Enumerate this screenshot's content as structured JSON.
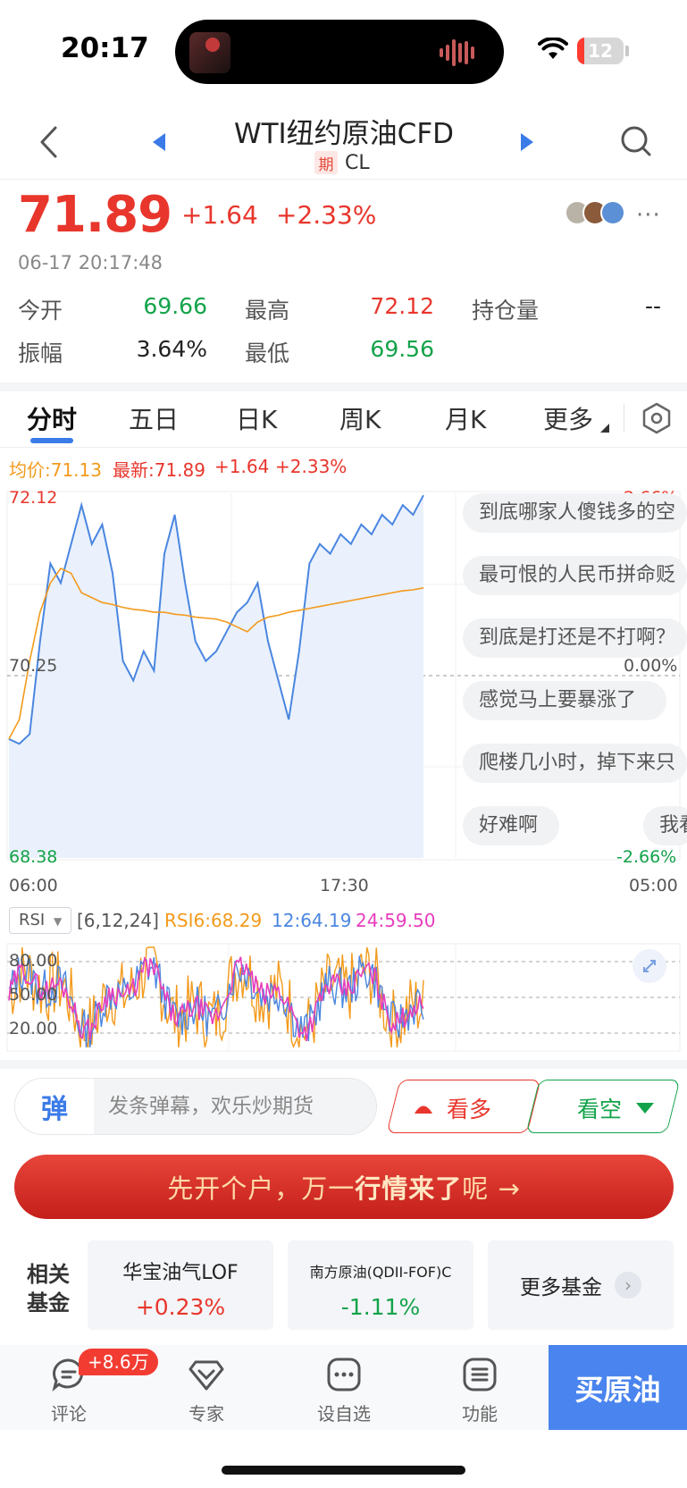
{
  "status_bar": {
    "time": "20:17",
    "battery": "12"
  },
  "header": {
    "title": "WTI纽约原油CFD",
    "tag": "期",
    "code": "CL"
  },
  "quote": {
    "price": "71.89",
    "change": "+1.64",
    "change_pct": "+2.33%",
    "datetime": "06-17 20:17:48",
    "more": "···"
  },
  "stats": {
    "open_label": "今开",
    "open": "69.66",
    "high_label": "最高",
    "high": "72.12",
    "oi_label": "持仓量",
    "oi": "--",
    "amp_label": "振幅",
    "amp": "3.64%",
    "low_label": "最低",
    "low": "69.56"
  },
  "tabs": [
    "分时",
    "五日",
    "日K",
    "周K",
    "月K",
    "更多"
  ],
  "legend": {
    "avg": "均价:71.13",
    "latest": "最新:71.89",
    "change": "+1.64",
    "pct": "+2.33%"
  },
  "chart_data": {
    "type": "line",
    "y_ticks_left": [
      "72.12",
      "70.25",
      "68.38"
    ],
    "y_ticks_right": [
      "2.66%",
      "0.00%",
      "-2.66%"
    ],
    "x_ticks": [
      "06:00",
      "17:30",
      "05:00"
    ],
    "ylim": [
      68.38,
      72.12
    ],
    "reference": 70.25,
    "grid": true,
    "series": [
      {
        "name": "最新",
        "color": "#4a86e0",
        "values": [
          69.6,
          69.55,
          69.65,
          70.6,
          71.4,
          71.2,
          71.6,
          72.0,
          71.6,
          71.8,
          71.3,
          70.4,
          70.2,
          70.5,
          70.3,
          71.5,
          71.9,
          71.2,
          70.6,
          70.4,
          70.5,
          70.7,
          70.9,
          71.0,
          71.2,
          70.6,
          70.2,
          69.8,
          70.5,
          71.4,
          71.6,
          71.5,
          71.7,
          71.6,
          71.8,
          71.7,
          71.9,
          71.8,
          72.0,
          71.9,
          72.1
        ]
      },
      {
        "name": "均价",
        "color": "#f39a1c",
        "values": [
          69.6,
          69.8,
          70.4,
          70.9,
          71.2,
          71.35,
          71.3,
          71.1,
          71.05,
          71.0,
          70.98,
          70.95,
          70.93,
          70.92,
          70.9,
          70.9,
          70.88,
          70.87,
          70.85,
          70.84,
          70.83,
          70.8,
          70.75,
          70.7,
          70.8,
          70.85,
          70.87,
          70.9,
          70.92,
          70.94,
          70.96,
          70.98,
          71.0,
          71.02,
          71.04,
          71.06,
          71.08,
          71.1,
          71.12,
          71.13,
          71.15
        ]
      }
    ]
  },
  "danmaku": [
    "到底哪家人傻钱多的空",
    "最可恨的人民币拼命贬",
    "到底是打还是不打啊？",
    "感觉马上要暴涨了",
    "爬楼几小时，掉下来只",
    "好难啊",
    "我看"
  ],
  "rsi": {
    "tag": "RSI",
    "params": "[6,12,24]",
    "rsi6": "RSI6:68.29",
    "rsi12": "12:64.19",
    "rsi24": "24:59.50",
    "levels": [
      "80.00",
      "50.00",
      "20.00"
    ],
    "colors": {
      "rsi6": "#f39a1c",
      "rsi12": "#4a86e0",
      "rsi24": "#e63dbd"
    }
  },
  "input": {
    "badge": "弹",
    "placeholder": "发条弹幕，欢乐炒期货"
  },
  "actions": {
    "bull": "看多",
    "bear": "看空"
  },
  "banner": {
    "part1": "先开个户，万一",
    "part2": "行情来了",
    "part3": "呢 →"
  },
  "funds": {
    "title_line1": "相关",
    "title_line2": "基金",
    "items": [
      {
        "name": "华宝油气LOF",
        "change": "+0.23%"
      },
      {
        "name": "南方原油(QDII-FOF)C",
        "change": "-1.11%"
      }
    ],
    "more": "更多基金"
  },
  "nav": {
    "items": [
      "评论",
      "专家",
      "设自选",
      "功能"
    ],
    "badge": "+8.6万",
    "buy": "买原油"
  }
}
